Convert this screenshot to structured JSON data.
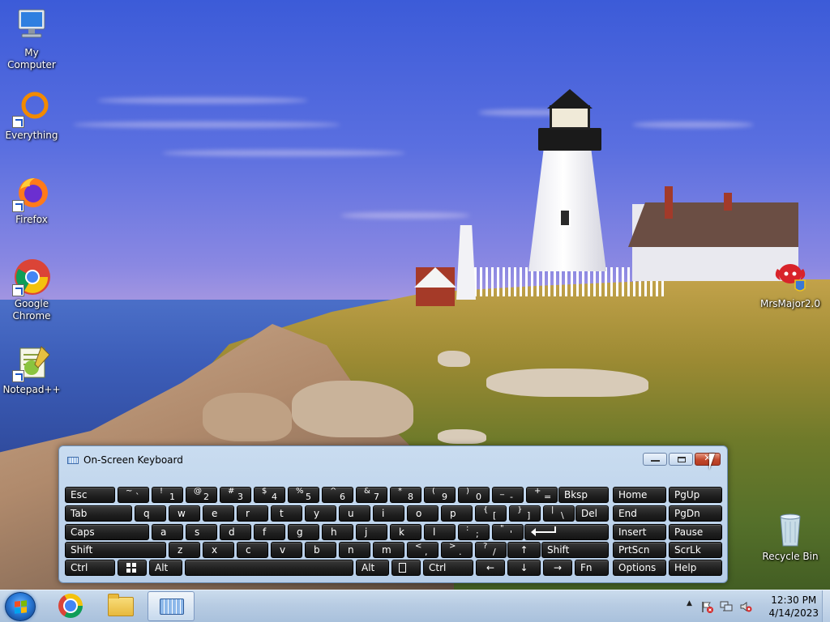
{
  "desktop": {
    "icons": [
      {
        "label": "My Computer"
      },
      {
        "label": "Everything"
      },
      {
        "label": "Firefox"
      },
      {
        "label": "Google\nChrome"
      },
      {
        "label": "Notepad++"
      },
      {
        "label": "MrsMajor2.0"
      },
      {
        "label": "Recycle Bin"
      }
    ]
  },
  "osk": {
    "title": "On-Screen Keyboard",
    "keys": {
      "esc": "Esc",
      "bksp": "Bksp",
      "home": "Home",
      "pgup": "PgUp",
      "tab": "Tab",
      "del": "Del",
      "end": "End",
      "pgdn": "PgDn",
      "caps": "Caps",
      "insert": "Insert",
      "pause": "Pause",
      "shift_l": "Shift",
      "shift_r": "Shift",
      "prtscn": "PrtScn",
      "scrlk": "ScrLk",
      "ctrl_l": "Ctrl",
      "alt_l": "Alt",
      "alt_r": "Alt",
      "ctrl_r": "Ctrl",
      "fn": "Fn",
      "options": "Options",
      "help": "Help",
      "arrow_up": "↑",
      "arrow_left": "←",
      "arrow_down": "↓",
      "arrow_right": "→",
      "row1": [
        {
          "shift": "~",
          "main": "`"
        },
        {
          "shift": "!",
          "main": "1"
        },
        {
          "shift": "@",
          "main": "2"
        },
        {
          "shift": "#",
          "main": "3"
        },
        {
          "shift": "$",
          "main": "4"
        },
        {
          "shift": "%",
          "main": "5"
        },
        {
          "shift": "^",
          "main": "6"
        },
        {
          "shift": "&",
          "main": "7"
        },
        {
          "shift": "*",
          "main": "8"
        },
        {
          "shift": "(",
          "main": "9"
        },
        {
          "shift": ")",
          "main": "0"
        },
        {
          "shift": "_",
          "main": "-"
        },
        {
          "shift": "+",
          "main": "="
        }
      ],
      "row2": [
        "q",
        "w",
        "e",
        "r",
        "t",
        "y",
        "u",
        "i",
        "o",
        "p"
      ],
      "row2_sym": [
        {
          "shift": "{",
          "main": "["
        },
        {
          "shift": "}",
          "main": "]"
        },
        {
          "shift": "|",
          "main": "\\"
        }
      ],
      "row3": [
        "a",
        "s",
        "d",
        "f",
        "g",
        "h",
        "j",
        "k",
        "l"
      ],
      "row3_sym": [
        {
          "shift": ":",
          "main": ";"
        },
        {
          "shift": "\"",
          "main": "'"
        }
      ],
      "row4": [
        "z",
        "x",
        "c",
        "v",
        "b",
        "n",
        "m"
      ],
      "row4_sym": [
        {
          "shift": "<",
          "main": ","
        },
        {
          "shift": ">",
          "main": "."
        },
        {
          "shift": "?",
          "main": "/"
        }
      ]
    }
  },
  "taskbar": {
    "clock_time": "12:30 PM",
    "clock_date": "4/14/2023",
    "tray_arrow": "▲"
  },
  "colors": {
    "taskbar": "#b8cce3",
    "osk_frame": "#c9dcf0",
    "key": "#1e1e1e",
    "close": "#c2482c"
  }
}
